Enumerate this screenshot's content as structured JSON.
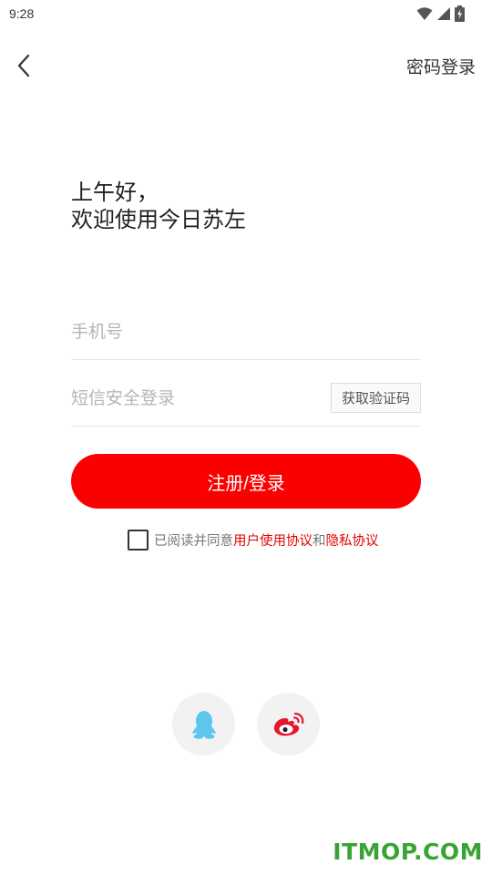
{
  "status_bar": {
    "time": "9:28",
    "icons": [
      "wifi-icon",
      "signal-icon",
      "battery-icon"
    ]
  },
  "nav": {
    "back_icon": "chevron-left-icon",
    "password_login_label": "密码登录"
  },
  "greeting": {
    "line1": "上午好，",
    "line2": "欢迎使用今日苏左"
  },
  "form": {
    "phone_placeholder": "手机号",
    "phone_value": "",
    "code_placeholder": "短信安全登录",
    "code_value": "",
    "get_code_label": "获取验证码",
    "submit_label": "注册/登录"
  },
  "agreement": {
    "checked": false,
    "prefix": "已阅读并同意",
    "user_agreement": "用户使用协议",
    "and": "和",
    "privacy_agreement": "隐私协议"
  },
  "social": {
    "qq_icon": "qq-penguin-icon",
    "weibo_icon": "weibo-icon"
  },
  "watermark": "ITMOP.COM",
  "colors": {
    "primary": "#fb0000",
    "link": "#e40000",
    "qq": "#5cc6ef",
    "weibo": "#e6162d",
    "watermark": "#3aa335"
  }
}
